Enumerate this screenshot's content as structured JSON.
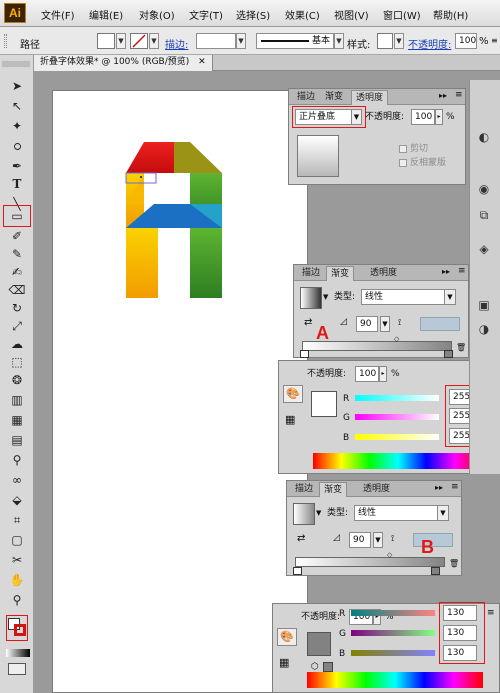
{
  "app": {
    "logo": "Ai"
  },
  "menu": [
    "文件(F)",
    "编辑(E)",
    "对象(O)",
    "文字(T)",
    "选择(S)",
    "效果(C)",
    "视图(V)",
    "窗口(W)",
    "帮助(H)"
  ],
  "control_bar": {
    "object_type": "路径",
    "stroke_label": "描边:",
    "stroke_style": "基本",
    "style_label": "样式:",
    "opacity_label": "不透明度:",
    "opacity_value": "100",
    "opacity_unit": "%"
  },
  "document_tab": {
    "title": "折叠字体效果* @ 100% (RGB/预览)",
    "close": "✕"
  },
  "panel_top": {
    "tabs": [
      "描边",
      "渐变",
      "透明度"
    ],
    "blend_mode": "正片叠底",
    "opacity_label": "不透明度:",
    "opacity_value": "100",
    "opacity_unit": "%",
    "checkbox_clip": "剪切",
    "checkbox_invert": "反相蒙版"
  },
  "gradient_a": {
    "tabs": [
      "描边",
      "渐变",
      "透明度"
    ],
    "type_label": "类型:",
    "type_value": "线性",
    "angle": "90",
    "marker": "A"
  },
  "color_a": {
    "opacity_label": "不透明度:",
    "opacity_value": "100",
    "opacity_unit": "%",
    "channels": [
      {
        "name": "R",
        "value": "255"
      },
      {
        "name": "G",
        "value": "255"
      },
      {
        "name": "B",
        "value": "255"
      }
    ]
  },
  "gradient_b": {
    "tabs": [
      "描边",
      "渐变",
      "透明度"
    ],
    "type_label": "类型:",
    "type_value": "线性",
    "angle": "90",
    "marker": "B"
  },
  "color_b": {
    "opacity_label": "不透明度:",
    "opacity_value": "100",
    "opacity_unit": "%",
    "channels": [
      {
        "name": "R",
        "value": "130"
      },
      {
        "name": "G",
        "value": "130"
      },
      {
        "name": "B",
        "value": "130"
      }
    ]
  },
  "colors": {
    "red": "#e21b1b",
    "olive": "#9a9a14",
    "green": "#3fa12a",
    "blue": "#1e6fc0",
    "cyan": "#1fa0c8",
    "yellow": "#f5b800",
    "annotation_red": "#e01818"
  }
}
